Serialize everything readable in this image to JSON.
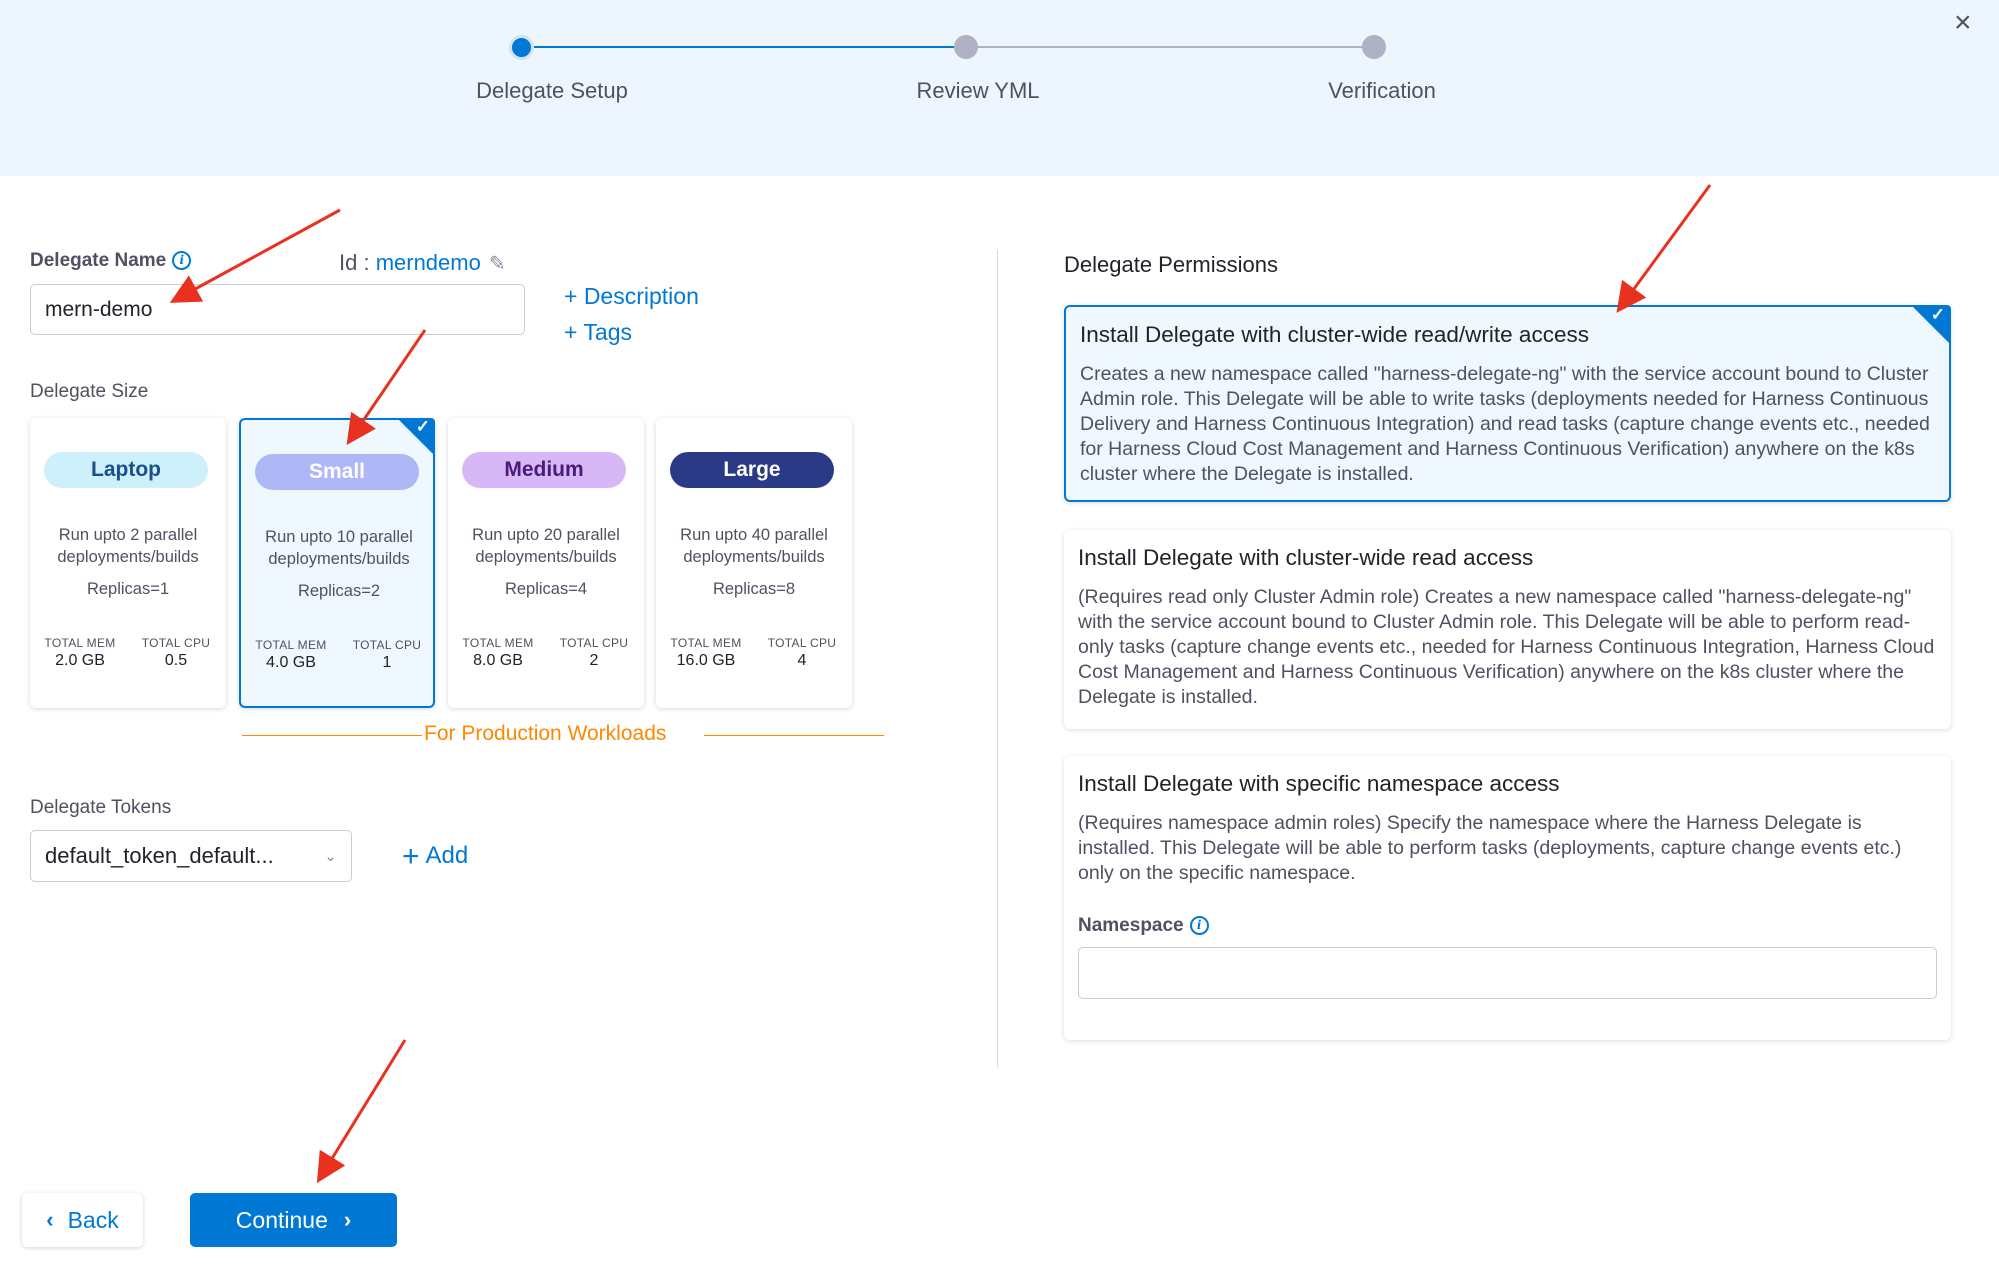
{
  "stepper": {
    "steps": [
      {
        "label": "Delegate Setup",
        "state": "active"
      },
      {
        "label": "Review YML",
        "state": "pending"
      },
      {
        "label": "Verification",
        "state": "pending"
      }
    ]
  },
  "close_icon": "×",
  "delegate_name": {
    "label": "Delegate Name",
    "value": "mern-demo",
    "id_prefix": "Id : ",
    "id_value": "merndemo"
  },
  "links": {
    "description": "+ Description",
    "tags": "+ Tags"
  },
  "delegate_size": {
    "label": "Delegate Size",
    "selected": "Small",
    "cards": [
      {
        "name": "Laptop",
        "desc": "Run upto 2 parallel deployments/builds",
        "replicas": "Replicas=1",
        "mem_label": "TOTAL MEM",
        "mem": "2.0 GB",
        "cpu_label": "TOTAL CPU",
        "cpu": "0.5",
        "pill_bg": "#cdf0fb",
        "pill_fg": "#1c4e8a"
      },
      {
        "name": "Small",
        "desc": "Run upto 10 parallel deployments/builds",
        "replicas": "Replicas=2",
        "mem_label": "TOTAL MEM",
        "mem": "4.0 GB",
        "cpu_label": "TOTAL CPU",
        "cpu": "1",
        "pill_bg": "#aeb8f7",
        "pill_fg": "#ffffff"
      },
      {
        "name": "Medium",
        "desc": "Run upto 20 parallel deployments/builds",
        "replicas": "Replicas=4",
        "mem_label": "TOTAL MEM",
        "mem": "8.0 GB",
        "cpu_label": "TOTAL CPU",
        "cpu": "2",
        "pill_bg": "#d7b8f7",
        "pill_fg": "#4b1a7a"
      },
      {
        "name": "Large",
        "desc": "Run upto 40 parallel deployments/builds",
        "replicas": "Replicas=8",
        "mem_label": "TOTAL MEM",
        "mem": "16.0 GB",
        "cpu_label": "TOTAL CPU",
        "cpu": "4",
        "pill_bg": "#2b3a86",
        "pill_fg": "#ffffff"
      }
    ],
    "production_label": "For Production Workloads"
  },
  "delegate_tokens": {
    "label": "Delegate Tokens",
    "selected": "default_token_default...",
    "add_label": "Add"
  },
  "permissions": {
    "title": "Delegate Permissions",
    "options": [
      {
        "heading": "Install Delegate with cluster-wide read/write access",
        "desc": "Creates a new namespace called \"harness-delegate-ng\" with the service account bound to Cluster Admin role. This Delegate will be able to write tasks (deployments needed for Harness Continuous Delivery and Harness Continuous Integration) and read tasks (capture change events etc., needed for Harness Cloud Cost Management and Harness Continuous Verification) anywhere on the k8s cluster where the Delegate is installed.",
        "selected": true
      },
      {
        "heading": "Install Delegate with cluster-wide read access",
        "desc": "(Requires read only Cluster Admin role) Creates a new namespace called \"harness-delegate-ng\" with the service account bound to Cluster Admin role. This Delegate will be able to perform read-only tasks (capture change events etc., needed for Harness Continuous Integration, Harness Cloud Cost Management and Harness Continuous Verification) anywhere on the k8s cluster where the Delegate is installed.",
        "selected": false
      },
      {
        "heading": "Install Delegate with specific namespace access",
        "desc": "(Requires namespace admin roles) Specify the namespace where the Harness Delegate is installed. This Delegate will be able to perform tasks (deployments, capture change events etc.) only on the specific namespace.",
        "selected": false
      }
    ],
    "namespace_label": "Namespace",
    "namespace_value": ""
  },
  "footer": {
    "back_label": "Back",
    "continue_label": "Continue"
  },
  "colors": {
    "primary": "#0278d5",
    "header_bg": "#edf6fd",
    "orange": "#ff8800",
    "annotation_red": "#e8321f"
  }
}
